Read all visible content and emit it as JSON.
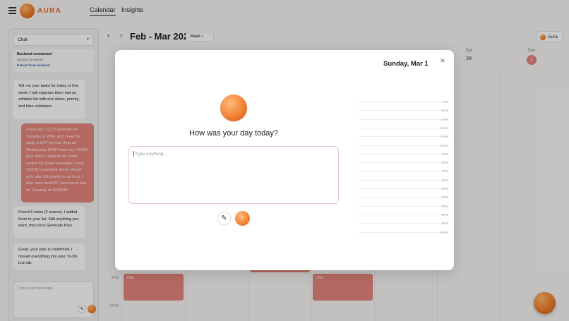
{
  "app": {
    "brand": "AURA",
    "nav": [
      {
        "label": "Calendar",
        "active": true
      },
      {
        "label": "Insights",
        "active": false
      }
    ]
  },
  "sidebar": {
    "chat_select": "Chat",
    "status": {
      "title": "Backend connected",
      "detail": "Synced 15 events.",
      "action": "Reload from backend"
    },
    "messages": [
      {
        "role": "bot",
        "text": "Tell me your tasks for today or this week. I will organize them into an editable list with due dates, priority, and time estimates."
      },
      {
        "role": "user",
        "text": "I have my CS173 Examlet on Tuesday at 2PM, and I need to study a LOT for that, then on Wednesday 8PM I have my CS128 quiz which I need to do some review for. Every weekday I have CS128 homework which should only take 30minutes to an hour. I also have Math257 homework due on Tuesday at 11:59PM"
      },
      {
        "role": "bot",
        "text": "Found 6 tasks (2 exams). I added them to your list. Edit anything you want, then click Generate Plan."
      },
      {
        "role": "bot",
        "text": "Great, your plan is confirmed. I moved everything into your To-Do List tab."
      }
    ],
    "input_placeholder": "Type your message..."
  },
  "calendar": {
    "title": "Feb - Mar 2026",
    "view": "Week",
    "aura_chip": "Aura",
    "days": [
      {
        "name": "Sat",
        "num": "28"
      },
      {
        "name": "Sun",
        "num": "1"
      }
    ],
    "time_labels": [
      "9PM",
      "10PM"
    ],
    "events": [
      {
        "label": "Club"
      },
      {
        "label": "Club"
      }
    ]
  },
  "modal": {
    "date": "Sunday, Mar 1",
    "question": "How was your day today?",
    "placeholder": "Type anything...",
    "hours": [
      "7AM",
      "8AM",
      "9AM",
      "10AM",
      "11AM",
      "12PM",
      "1PM",
      "2PM",
      "3PM",
      "4PM",
      "5PM",
      "6PM",
      "7PM",
      "8PM",
      "9PM",
      "10PM"
    ]
  },
  "colors": {
    "accent_orange": "#ee7a2a",
    "event_red": "#e1827b",
    "link_blue": "#3766b0"
  },
  "icons": {
    "menu": "hamburger-icon",
    "close": "close-icon",
    "pen": "pen-icon",
    "send": "arrow-up-icon",
    "prev": "chevron-left-icon",
    "next": "chevron-right-icon"
  }
}
